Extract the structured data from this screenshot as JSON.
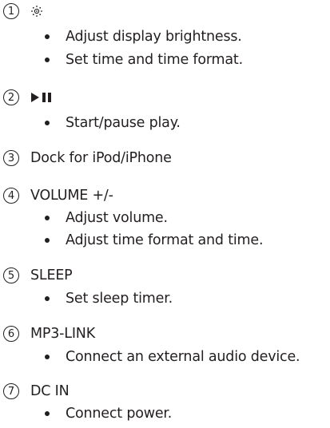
{
  "items": [
    {
      "number": "1",
      "title": "",
      "icon": "brightness-icon",
      "bullets": [
        "Adjust display brightness.",
        "Set time and time format."
      ]
    },
    {
      "number": "2",
      "title": "",
      "icon": "play-pause-icon",
      "bullets": [
        "Start/pause play."
      ]
    },
    {
      "number": "3",
      "title": "Dock for iPod/iPhone",
      "bullets": []
    },
    {
      "number": "4",
      "title": "VOLUME +/-",
      "bullets": [
        "Adjust volume.",
        "Adjust time format and time."
      ]
    },
    {
      "number": "5",
      "title": "SLEEP",
      "bullets": [
        "Set sleep timer."
      ]
    },
    {
      "number": "6",
      "title": "MP3-LINK",
      "bullets": [
        "Connect an external audio device."
      ]
    },
    {
      "number": "7",
      "title": "DC IN",
      "bullets": [
        "Connect power."
      ]
    }
  ]
}
